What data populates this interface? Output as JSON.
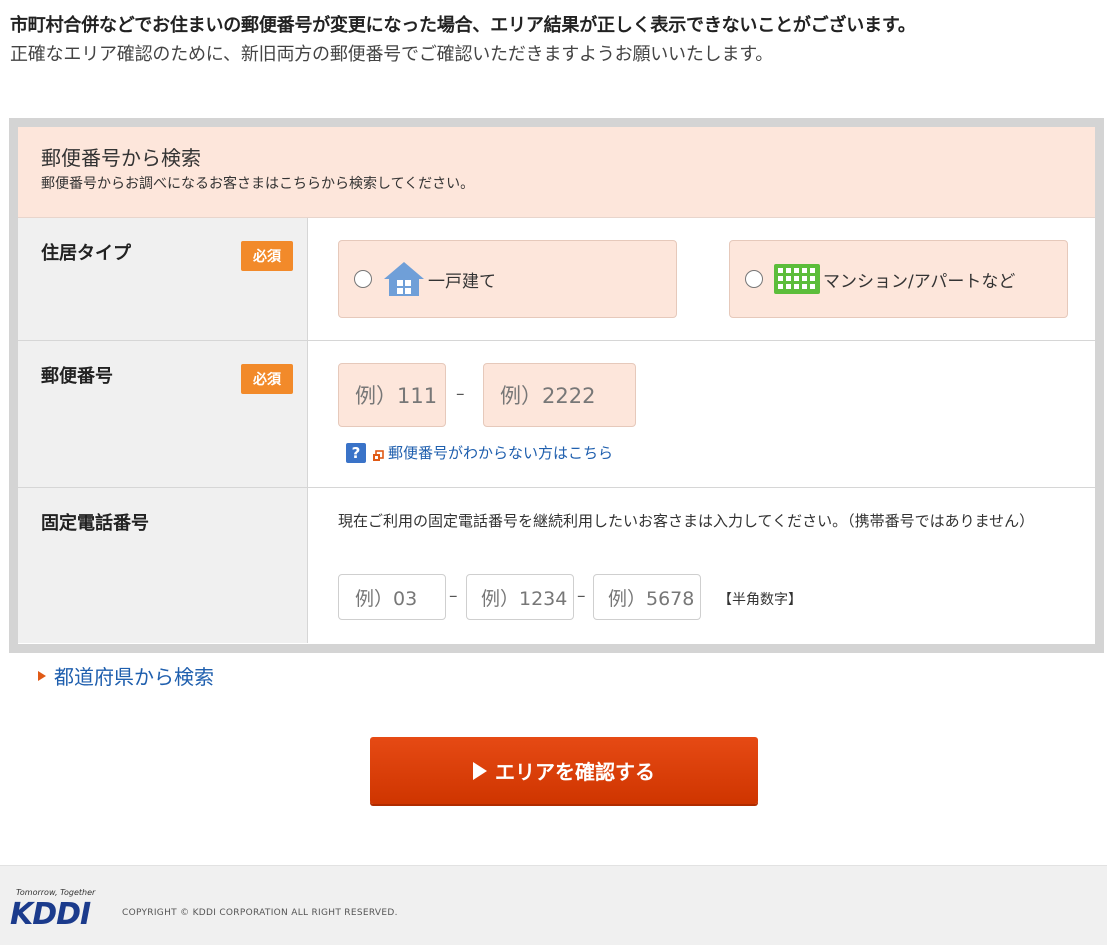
{
  "notice": {
    "line1": "市町村合併などでお住まいの郵便番号が変更になった場合、エリア結果が正しく表示できないことがございます。",
    "line2": "正確なエリア確認のために、新旧両方の郵便番号でご確認いただきますようお願いいたします。"
  },
  "panel": {
    "title": "郵便番号から検索",
    "subtitle": "郵便番号からお調べになるお客さまはこちらから検索してください。"
  },
  "residence": {
    "label": "住居タイプ",
    "badge": "必須",
    "options": [
      {
        "label": "一戸建て",
        "icon": "house-icon"
      },
      {
        "label": "マンション/アパートなど",
        "icon": "building-icon"
      }
    ]
  },
  "postal": {
    "label": "郵便番号",
    "badge": "必須",
    "placeholder1": "例）111",
    "placeholder2": "例）2222",
    "dash": "–",
    "help_link": "郵便番号がわからない方はこちら",
    "help_icon_text": "?"
  },
  "phone": {
    "label": "固定電話番号",
    "description": "現在ご利用の固定電話番号を継続利用したいお客さまは入力してください。（携帯番号ではありません）",
    "placeholder1": "例）03",
    "placeholder2": "例）1234",
    "placeholder3": "例）5678",
    "dash": "–",
    "note": "【半角数字】"
  },
  "pref_search": "都道府県から検索",
  "confirm_button": "エリアを確認する",
  "footer": {
    "tagline": "Tomorrow, Together",
    "logo": "KDDI",
    "copyright": "COPYRIGHT © KDDI CORPORATION ALL RIGHT RESERVED."
  },
  "colors": {
    "accent": "#d83d08",
    "badge": "#f28a2a",
    "panel_bg": "#fde6db",
    "link": "#1f5fae",
    "logo": "#1b3b8c"
  }
}
